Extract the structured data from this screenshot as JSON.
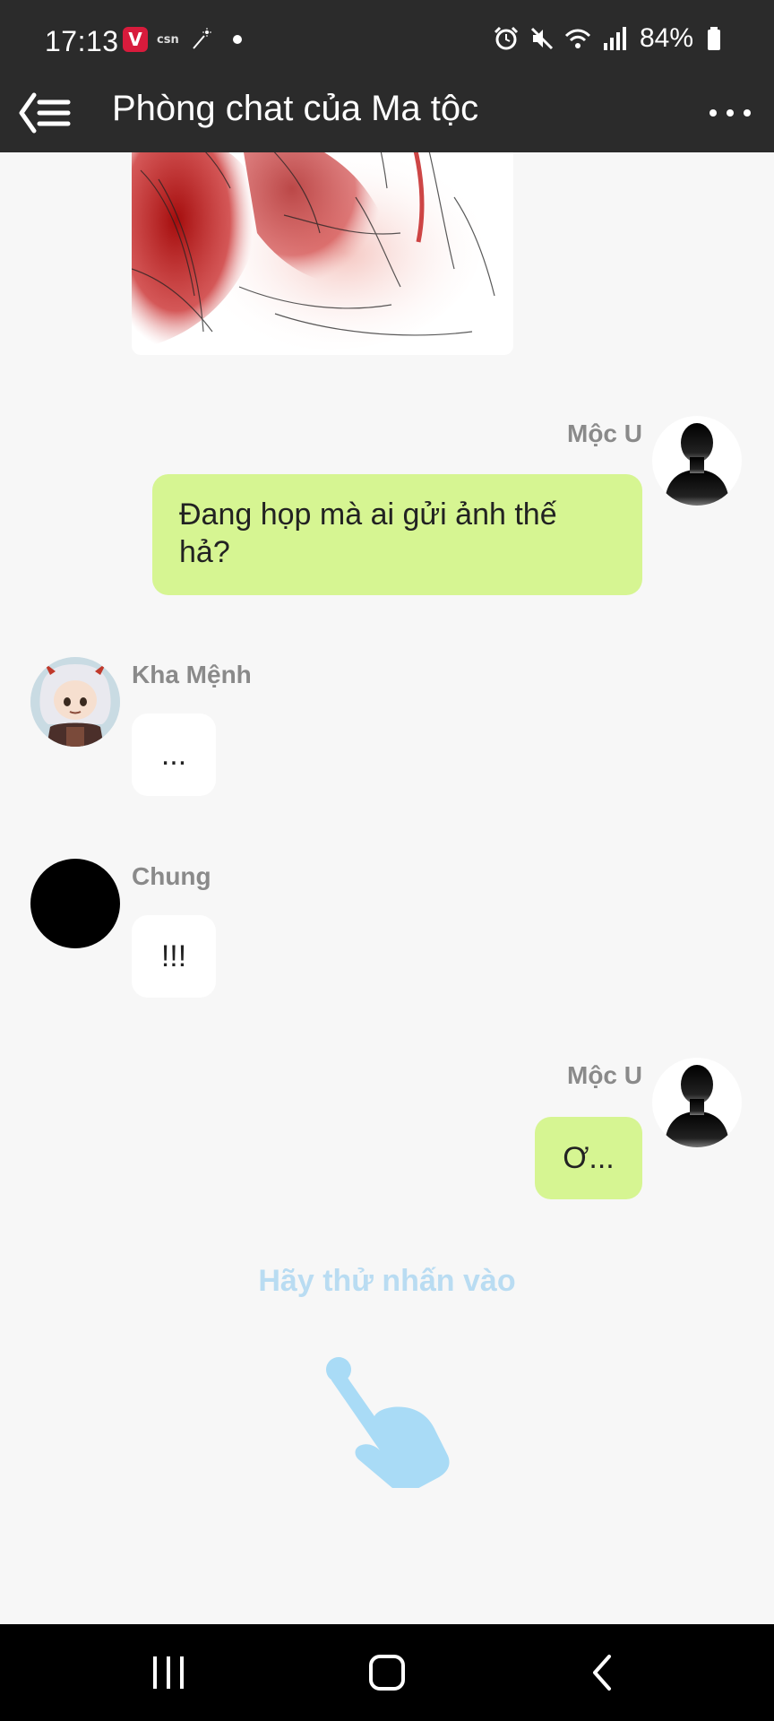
{
  "status_bar": {
    "time": "17:13",
    "left_icons": [
      "vivaldi-icon",
      "csn-icon",
      "magic-wand-icon",
      "notification-dot-icon"
    ],
    "csn_label": "csn",
    "right_icons": [
      "alarm-icon",
      "mute-icon",
      "wifi-icon",
      "signal-icon",
      "battery-icon"
    ],
    "battery": "84%"
  },
  "app_bar": {
    "title": "Phòng chat của Ma tộc",
    "back_icon": "back-list-icon",
    "overflow_icon": "more-dots-icon"
  },
  "messages": [
    {
      "type": "image",
      "side": "left",
      "image_desc": "sketch-with-red-ink"
    },
    {
      "type": "text",
      "side": "right",
      "sender": "Mộc U",
      "avatar": "silhouette",
      "lines": [
        "Đang họp mà ai gửi ảnh thế",
        "hả?"
      ]
    },
    {
      "type": "text",
      "side": "left",
      "sender": "Kha Mệnh",
      "avatar": "anime-character",
      "text": "..."
    },
    {
      "type": "text",
      "side": "left",
      "sender": "Chung",
      "avatar": "black-circle",
      "text": "!!!"
    },
    {
      "type": "text",
      "side": "right",
      "sender": "Mộc U",
      "avatar": "silhouette",
      "text": "Ơ..."
    }
  ],
  "hint": {
    "text": "Hãy thử nhấn vào",
    "icon": "tap-hand-icon"
  },
  "colors": {
    "top_bar": "#2b2b2b",
    "background": "#f7f7f7",
    "right_bubble": "#d6f592",
    "left_bubble": "#ffffff",
    "hint": "#b9dcf2",
    "name_label": "#8a8a8a"
  },
  "nav_bar": {
    "buttons": [
      "recent-apps-icon",
      "home-icon",
      "back-icon"
    ]
  }
}
